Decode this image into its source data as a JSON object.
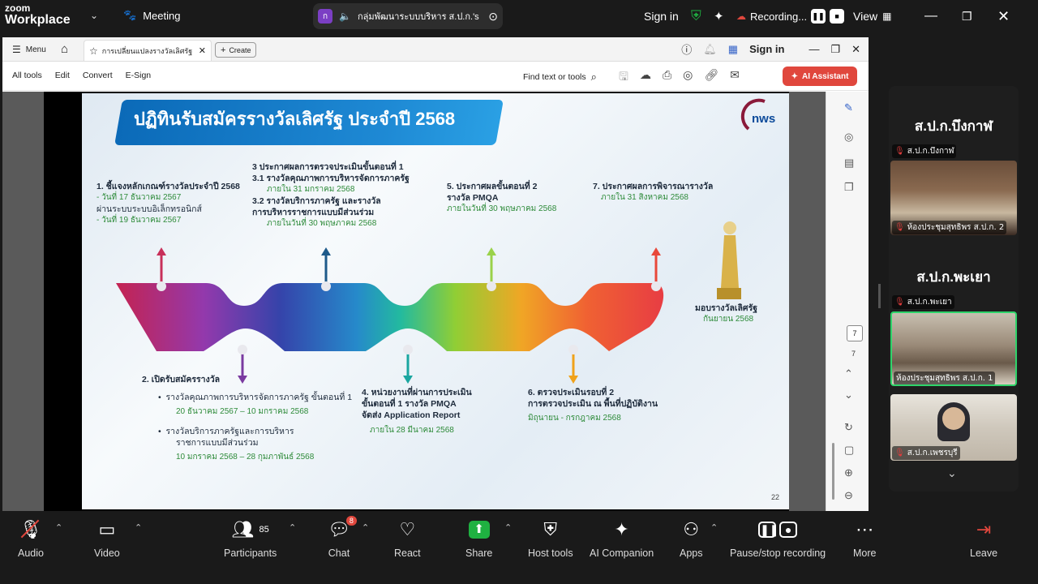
{
  "zoom": {
    "brand_top": "zoom",
    "brand_bottom": "Workplace",
    "meeting_label": "Meeting",
    "share_avatar": "ก",
    "share_title": "กลุ่มพัฒนาระบบบริหาร ส.ป.ก.'s :",
    "sign_in": "Sign in",
    "recording": "Recording...",
    "view": "View"
  },
  "pdf": {
    "menu": "Menu",
    "tab_title": "การเปลี่ยนแปลงรางวัลเลิศรัฐ 2...",
    "create": "Create",
    "sign_in": "Sign in",
    "tools": [
      "All tools",
      "Edit",
      "Convert",
      "E-Sign"
    ],
    "find": "Find text or tools",
    "ai": "AI Assistant",
    "page_current": "7",
    "page_total": "7"
  },
  "slide": {
    "title": "ปฏิทินรับสมัครรางวัลเลิศรัฐ ประจำปี 2568",
    "logo": "nws",
    "page_num": "22",
    "s1": "1. ชี้แจงหลักเกณฑ์รางวัลประจำปี 2568",
    "s1a": "- วันที่ 17 ธันวาคม 2567",
    "s1b": "ผ่านระบบระบบอิเล็กทรอนิกส์",
    "s1c": "- วันที่ 19 ธันวาคม 2567",
    "s3": "3 ประกาศผลการตรวจประเมินขั้นตอนที่ 1",
    "s3_1": "3.1 รางวัลคุณภาพการบริหารจัดการภาครัฐ",
    "s3_1d": "ภายใน 31 มกราคม 2568",
    "s3_2a": "3.2 รางวัลบริการภาครัฐ และรางวัล",
    "s3_2b": "การบริหารราชการแบบมีส่วนร่วม",
    "s3_2d": "ภายในวันที่ 30 พฤษภาคม 2568",
    "s5a": "5. ประกาศผลขั้นตอนที่ 2",
    "s5b": "รางวัล PMQA",
    "s5d": "ภายในวันที่ 30 พฤษภาคม 2568",
    "s7": "7. ประกาศผลการพิจารณารางวัล",
    "s7d": "ภายใน 31 สิงหาคม 2568",
    "award": "มอบรางวัลเลิศรัฐ",
    "award_d": "กันยายน 2568",
    "s2": "2. เปิดรับสมัครรางวัล",
    "s2a": "รางวัลคุณภาพการบริหารจัดการภาครัฐ ขั้นตอนที่ 1",
    "s2a_d": "20 ธันวาคม 2567 – 10 มกราคม 2568",
    "s2b1": "รางวัลบริการภาครัฐและการบริหาร",
    "s2b2": "ราชการแบบมีส่วนร่วม",
    "s2b_d": "10 มกราคม 2568 – 28 กุมภาพันธ์ 2568",
    "s4a": "4. หน่วยงานที่ผ่านการประเมิน",
    "s4b": "ขั้นตอนที่ 1 รางวัล PMQA",
    "s4c": "จัดส่ง Application Report",
    "s4d": "ภายใน 28 มีนาคม 2568",
    "s6a": "6. ตรวจประเมินรอบที่ 2",
    "s6b": "การตรวจประเมิน ณ พื้นที่ปฏิบัติงาน",
    "s6d": "มิถุนายน - กรกฎาคม 2568"
  },
  "gallery": {
    "p1_big": "ส.ป.ก.บึงกาฬ",
    "p1_label": "ส.ป.ก.บึงกาฬ",
    "p1_room": "ห้องประชุมสุทธิพร ส.ป.ก. 2",
    "p2_big": "ส.ป.ก.พะเยา",
    "p2_label": "ส.ป.ก.พะเยา",
    "p2_room": "ห้องประชุมสุทธิพร ส.ป.ก. 1",
    "p3_label": "ส.ป.ก.เพชรบุรี"
  },
  "controls": {
    "audio": "Audio",
    "video": "Video",
    "participants": "Participants",
    "participants_count": "85",
    "chat": "Chat",
    "chat_badge": "8",
    "react": "React",
    "share": "Share",
    "host_tools": "Host tools",
    "ai_companion": "AI Companion",
    "apps": "Apps",
    "pause_stop": "Pause/stop recording",
    "more": "More",
    "leave": "Leave"
  },
  "colors": {
    "share_green": "#1fb141",
    "recording_red": "#e0473d",
    "ai_button": "#e0473d"
  }
}
